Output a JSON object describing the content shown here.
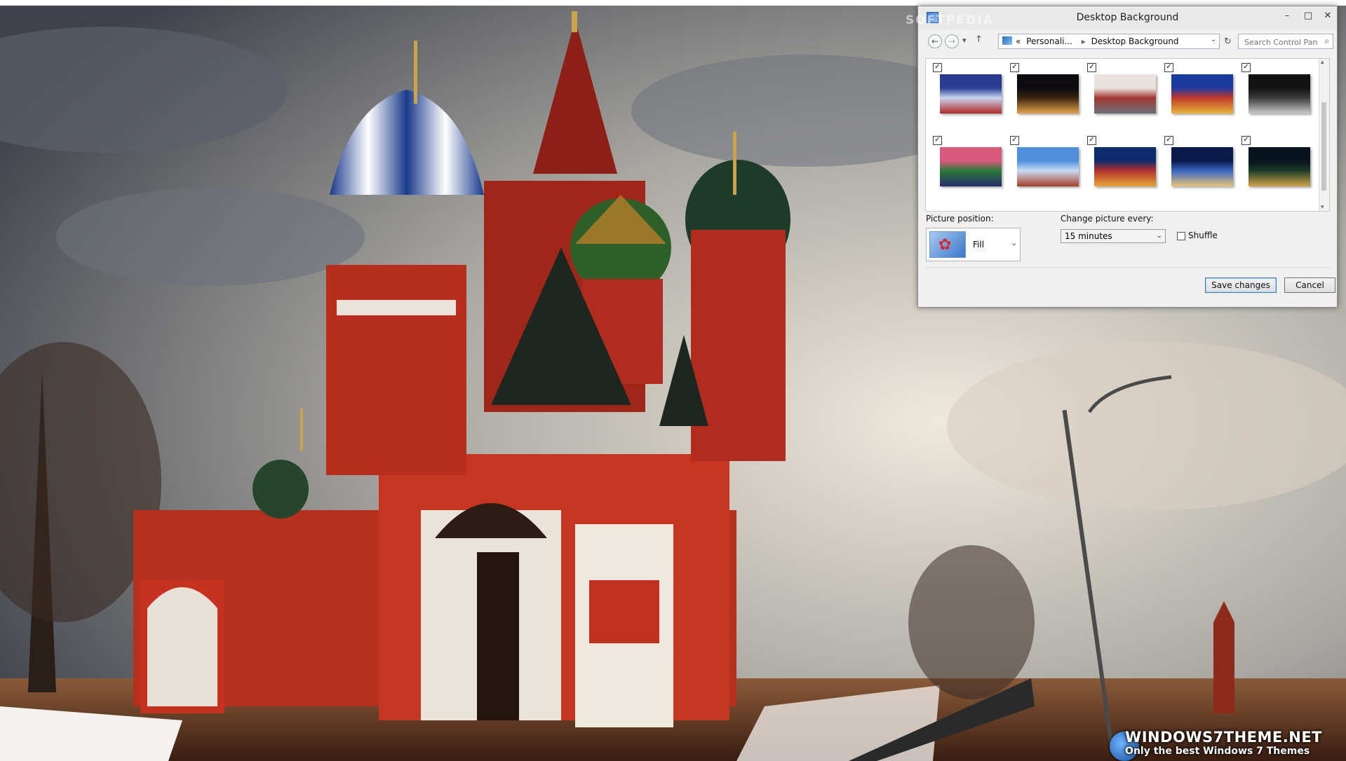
{
  "window": {
    "title": "Desktop Background",
    "minimize_glyph": "–",
    "maximize_glyph": "□",
    "close_glyph": "✕"
  },
  "nav": {
    "back_glyph": "←",
    "forward_glyph": "→",
    "recent_glyph": "▾",
    "up_glyph": "↑",
    "breadcrumb_prefix": "«",
    "breadcrumb": [
      "Personali...",
      "Desktop Background"
    ],
    "breadcrumb_separator": "▸",
    "refresh_glyph": "↻",
    "search_placeholder": "Search Control Panel",
    "search_glyph": "⌕"
  },
  "gallery": {
    "check_glyph": "✓",
    "thumbnails": [
      {
        "name": "thumb-1",
        "checked": true,
        "colors": [
          "#2a3c8f",
          "#c7d4ee",
          "#b02a2a"
        ]
      },
      {
        "name": "thumb-2",
        "checked": true,
        "colors": [
          "#0d0b10",
          "#3a2315",
          "#e2a24a"
        ]
      },
      {
        "name": "thumb-3",
        "checked": true,
        "colors": [
          "#e9e2df",
          "#a23a34",
          "#6e6e78"
        ]
      },
      {
        "name": "thumb-4",
        "checked": true,
        "colors": [
          "#1b3a9d",
          "#c0392b",
          "#e6b43c"
        ]
      },
      {
        "name": "thumb-5",
        "checked": true,
        "colors": [
          "#121212",
          "#3b3b3b",
          "#c9c9c9"
        ]
      },
      {
        "name": "thumb-6",
        "checked": true,
        "colors": [
          "#d8597c",
          "#2b7a3a",
          "#2a2a6b"
        ]
      },
      {
        "name": "thumb-7",
        "checked": true,
        "colors": [
          "#4f8fdc",
          "#c9dcf3",
          "#a6402a"
        ]
      },
      {
        "name": "thumb-8",
        "checked": true,
        "colors": [
          "#0e2b6b",
          "#b3322c",
          "#e5a63a"
        ]
      },
      {
        "name": "thumb-9",
        "checked": true,
        "colors": [
          "#0a1a4a",
          "#3a64c2",
          "#e8c37a"
        ]
      },
      {
        "name": "thumb-10",
        "checked": true,
        "colors": [
          "#07141f",
          "#1d3c2a",
          "#d1a24a"
        ]
      }
    ],
    "scroll_up_glyph": "▴",
    "scroll_down_glyph": "▾"
  },
  "picture_position": {
    "label": "Picture position:",
    "value": "Fill",
    "icon": "flower-icon"
  },
  "change_interval": {
    "label": "Change picture every:",
    "value": "15 minutes"
  },
  "shuffle": {
    "label": "Shuffle",
    "checked": false
  },
  "buttons": {
    "save": "Save changes",
    "cancel": "Cancel"
  },
  "dropdown_glyph": "⌄",
  "watermark": {
    "brand": "WINDOWS7THEME.NET",
    "tagline": "Only the best Windows 7 Themes",
    "overlay_text": "SOFTPEDIA"
  },
  "colors": {
    "window_bg": "#f0f0f0",
    "accent": "#3c7fb1"
  }
}
